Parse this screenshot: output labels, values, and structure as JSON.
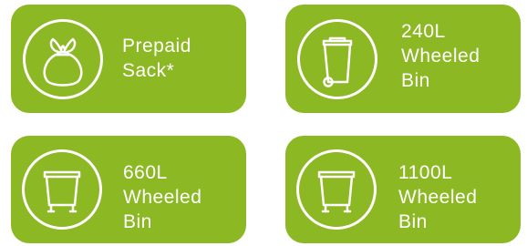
{
  "options": [
    {
      "id": "prepaid-sack",
      "lines": [
        "Prepaid",
        "Sack*"
      ],
      "icon": "sack-icon"
    },
    {
      "id": "240l-wheeled-bin",
      "lines": [
        "240L",
        "Wheeled",
        "Bin"
      ],
      "icon": "wheelie-bin-icon"
    },
    {
      "id": "660l-wheeled-bin",
      "lines": [
        "660L",
        "Wheeled",
        "Bin"
      ],
      "icon": "large-bin-icon"
    },
    {
      "id": "1100l-wheeled-bin",
      "lines": [
        "1100L",
        "Wheeled",
        "Bin"
      ],
      "icon": "large-bin-icon"
    }
  ],
  "colors": {
    "card_background": "#8cb823",
    "foreground": "#ffffff"
  }
}
